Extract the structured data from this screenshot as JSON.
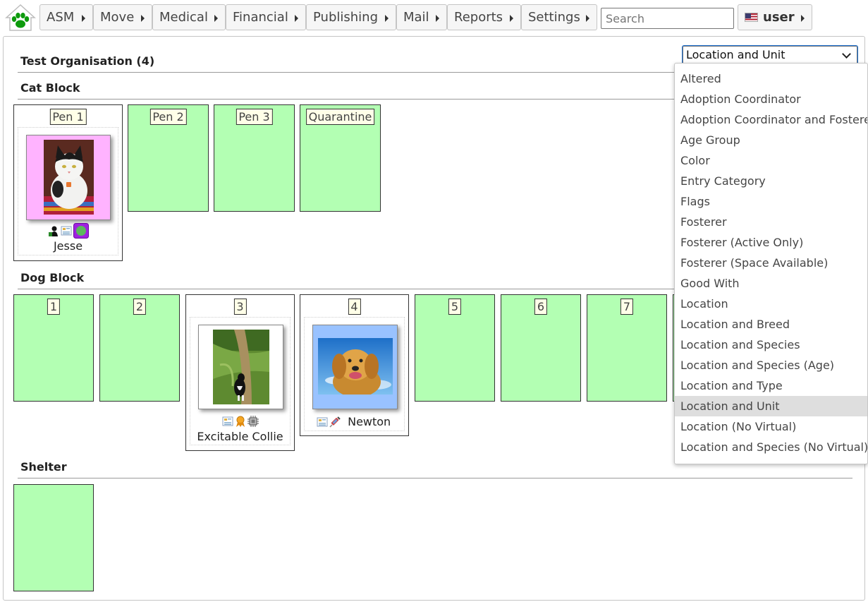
{
  "nav": {
    "menus": [
      {
        "label": "ASM"
      },
      {
        "label": "Move"
      },
      {
        "label": "Medical"
      },
      {
        "label": "Financial"
      },
      {
        "label": "Publishing"
      },
      {
        "label": "Mail"
      },
      {
        "label": "Reports"
      },
      {
        "label": "Settings"
      }
    ],
    "search_placeholder": "Search",
    "user_label": "user"
  },
  "view": {
    "selected": "Location and Unit",
    "options": [
      "Altered",
      "Adoption Coordinator",
      "Adoption Coordinator and Fosterer",
      "Age Group",
      "Color",
      "Entry Category",
      "Flags",
      "Fosterer",
      "Fosterer (Active Only)",
      "Fosterer (Space Available)",
      "Good With",
      "Location",
      "Location and Breed",
      "Location and Species",
      "Location and Species (Age)",
      "Location and Type",
      "Location and Unit",
      "Location (No Virtual)",
      "Location and Species (No Virtual)"
    ]
  },
  "org": {
    "title": "Test Organisation (4)"
  },
  "locations": [
    {
      "name": "Cat Block",
      "units": [
        {
          "label": "Pen 1",
          "animal": {
            "name": "Jesse"
          }
        },
        {
          "label": "Pen 2"
        },
        {
          "label": "Pen 3"
        },
        {
          "label": "Quarantine"
        }
      ]
    },
    {
      "name": "Dog Block",
      "units": [
        {
          "label": "1"
        },
        {
          "label": "2"
        },
        {
          "label": "3",
          "animal": {
            "name": "Excitable Collie"
          }
        },
        {
          "label": "4",
          "animal": {
            "name": "Newton"
          }
        },
        {
          "label": "5"
        },
        {
          "label": "6"
        },
        {
          "label": "7"
        }
      ]
    },
    {
      "name": "Shelter",
      "units": [
        {
          "label": ""
        }
      ]
    }
  ],
  "colors": {
    "empty_unit": "#b3ffb3",
    "cat_thumb_bg": "#ffb3ff",
    "dog_thumb_bg_blue": "#99c2ff",
    "logo_green": "#0d9a0d"
  }
}
